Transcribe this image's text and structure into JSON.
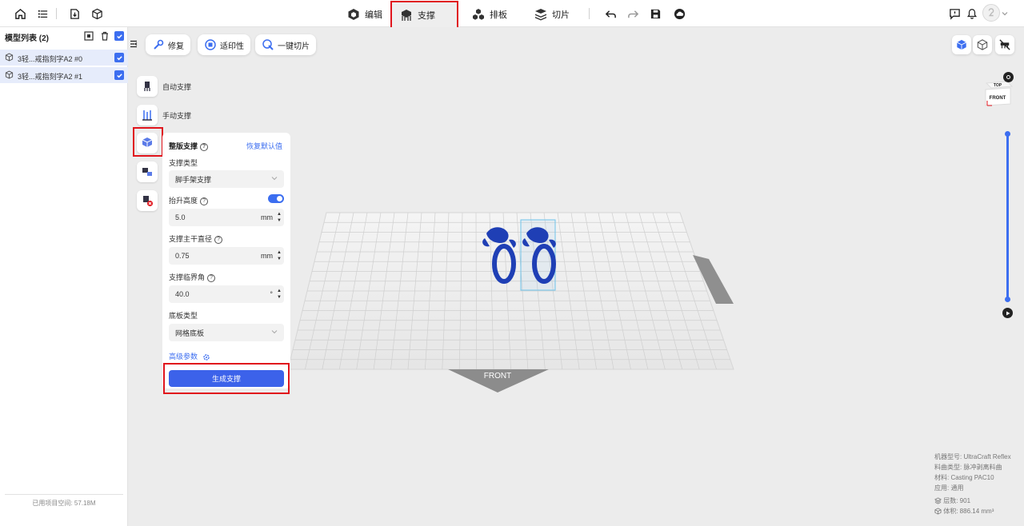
{
  "topbar": {
    "left_icons": [
      "home-icon",
      "list-icon",
      "import-icon",
      "cube-icon"
    ],
    "tabs": [
      {
        "label": "编辑",
        "icon": "edit-cube-icon",
        "active": false
      },
      {
        "label": "支撑",
        "icon": "support-icon",
        "active": true
      },
      {
        "label": "排板",
        "icon": "layout-icon",
        "active": false
      },
      {
        "label": "切片",
        "icon": "slice-icon",
        "active": false
      }
    ],
    "actions": [
      "undo-icon",
      "redo-icon",
      "save-icon",
      "cloud-icon"
    ],
    "right_icons": [
      "feedback-icon",
      "bell-icon",
      "avatar"
    ]
  },
  "sidebar": {
    "title": "模型列表 (2)",
    "models": [
      {
        "name": "3轻...戒指刻字A2 #0",
        "checked": true
      },
      {
        "name": "3轻...戒指刻字A2 #1",
        "checked": true
      }
    ],
    "storage": "已用项目空间: 57.18M"
  },
  "toolbar": {
    "repair": "修复",
    "printability": "适印性",
    "one_click_slice": "一键切片"
  },
  "support_tools": {
    "auto": "自动支撑",
    "manual": "手动支撑"
  },
  "support_panel": {
    "title": "整版支撑",
    "reset": "恢复默认值",
    "support_type_label": "支撑类型",
    "support_type_value": "脚手架支撑",
    "lift_height_label": "抬升高度",
    "lift_height_enabled": true,
    "lift_height_value": "5.0",
    "lift_height_unit": "mm",
    "trunk_diameter_label": "支撑主干直径",
    "trunk_diameter_value": "0.75",
    "trunk_diameter_unit": "mm",
    "critical_angle_label": "支撑临界角",
    "critical_angle_value": "40.0",
    "critical_angle_unit": "°",
    "base_type_label": "底板类型",
    "base_type_value": "网格底板",
    "advanced": "高级参数",
    "generate": "生成支撑"
  },
  "viewport": {
    "front_label": "FRONT",
    "cube_top": "TOP",
    "cube_front": "FRONT",
    "model_color": "#1f3fb5"
  },
  "info": {
    "machine": "机器型号: UltraCraft Reflex",
    "material_type": "料曲类型: 脉冲剥离料曲",
    "material": "材料: Casting PAC10",
    "application": "应用: 通用",
    "layers": "层数: 901",
    "volume": "体积: 886.14 mm³"
  },
  "colors": {
    "accent": "#3c6ef0",
    "highlight": "#e0141c"
  }
}
